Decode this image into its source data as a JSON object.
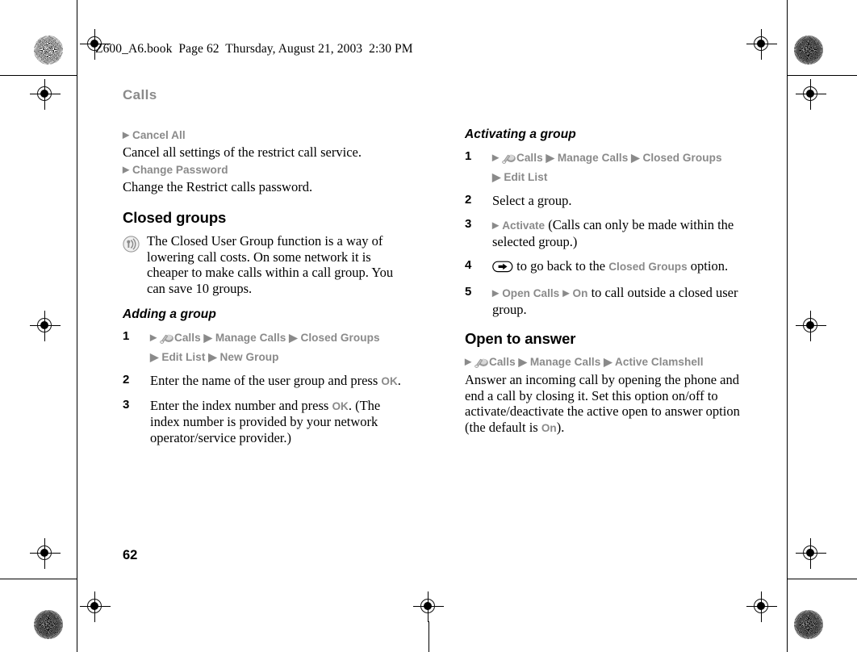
{
  "header": {
    "text": "Z600_A6.book  Page 62  Thursday, August 21, 2003  2:30 PM"
  },
  "page": {
    "title": "Calls",
    "number": "62"
  },
  "colors": {
    "ui_gray": "#8a8a8a",
    "body_black": "#000000",
    "page_bg": "#ffffff"
  },
  "left_column": {
    "menu_items": [
      {
        "marker": "▶",
        "label": "Cancel All",
        "description": "Cancel all settings of the restrict call service."
      },
      {
        "marker": "▶",
        "label": "Change Password",
        "description": "Change the Restrict calls password."
      }
    ],
    "section_heading": "Closed groups",
    "note": {
      "icon": "signal-antenna-icon",
      "text": "The Closed User Group function is a way of lowering call costs. On some network it is cheaper to make calls within a call group. You can save 10 groups."
    },
    "sub_heading": "Adding a group",
    "steps": [
      {
        "num": "1",
        "type": "path",
        "icon": "calls-handset-icon",
        "path_line1": "Calls ▶ Manage Calls ▶ Closed Groups",
        "path_line2": "▶ Edit List ▶ New Group"
      },
      {
        "num": "2",
        "type": "text",
        "text_before": "Enter the name of the user group and press ",
        "ui_term": "OK",
        "text_after": "."
      },
      {
        "num": "3",
        "type": "text",
        "text_before": "Enter the index number and press ",
        "ui_term": "OK",
        "text_after": ". (The index number is provided by your network operator/service provider.)"
      }
    ]
  },
  "right_column": {
    "sub_heading": "Activating a group",
    "steps": [
      {
        "num": "1",
        "type": "path",
        "icon": "calls-handset-icon",
        "path_line1": "Calls ▶ Manage Calls ▶ Closed Groups",
        "path_line2": "▶ Edit List"
      },
      {
        "num": "2",
        "type": "text",
        "text_before": "Select a group.",
        "ui_term": "",
        "text_after": ""
      },
      {
        "num": "3",
        "type": "ui_then_text",
        "ui_term": "Activate",
        "text_after": " (Calls can only be made within the selected group.)"
      },
      {
        "num": "4",
        "type": "back_icon",
        "icon": "back-arrow-button-icon",
        "text_before": " to go back to the ",
        "ui_term": "Closed Groups",
        "text_after": " option."
      },
      {
        "num": "5",
        "type": "ui_pair_then_text",
        "ui_term": "Open Calls",
        "ui_term2": "On",
        "text_after": " to call outside a closed user group."
      }
    ],
    "section_heading": "Open to answer",
    "path": {
      "icon": "calls-handset-icon",
      "text": "Calls ▶ Manage Calls ▶ Active Clamshell"
    },
    "body_before": "Answer an incoming call by opening the phone and end a call by closing it. Set this option on/off to activate/deactivate the active open to answer option (the default is ",
    "body_ui_term": "On",
    "body_after": ")."
  }
}
